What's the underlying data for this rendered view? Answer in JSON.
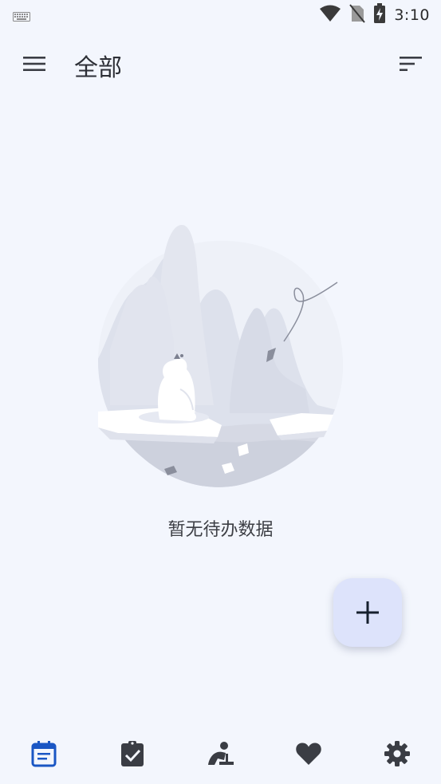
{
  "status_bar": {
    "time": "3:10",
    "icons": [
      "keyboard-icon",
      "wifi-icon",
      "no-sim-icon",
      "battery-charging-icon"
    ]
  },
  "app_bar": {
    "title": "全部",
    "menu_icon": "menu-icon",
    "sort_icon": "sort-icon"
  },
  "empty_state": {
    "illustration": "polar-bear-iceberg-illustration",
    "message": "暂无待办数据"
  },
  "fab": {
    "icon": "plus-icon"
  },
  "bottom_nav": {
    "active_index": 0,
    "active_color": "#1a56c4",
    "inactive_color": "#3a3d44",
    "items": [
      {
        "icon": "calendar-icon"
      },
      {
        "icon": "clipboard-check-icon"
      },
      {
        "icon": "person-desk-icon"
      },
      {
        "icon": "heart-icon"
      },
      {
        "icon": "gear-icon"
      }
    ]
  }
}
